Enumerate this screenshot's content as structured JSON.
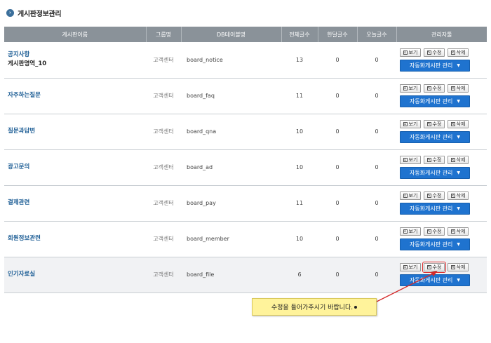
{
  "page": {
    "title": "게시판정보관리",
    "title_icon": "bullet-icon"
  },
  "table": {
    "headers": [
      "게시판이름",
      "그룹명",
      "DB테이블명",
      "전체글수",
      "한달글수",
      "오늘글수",
      "관리자툴"
    ],
    "rows": [
      {
        "name": "공지사항",
        "sub": "게시판명역_10",
        "group": "고객센터",
        "db": "board_notice",
        "total": "13",
        "month": "0",
        "today": "0"
      },
      {
        "name": "자주하는질문",
        "sub": "",
        "group": "고객센터",
        "db": "board_faq",
        "total": "11",
        "month": "0",
        "today": "0"
      },
      {
        "name": "질문과답변",
        "sub": "",
        "group": "고객센터",
        "db": "board_qna",
        "total": "10",
        "month": "0",
        "today": "0"
      },
      {
        "name": "광고문의",
        "sub": "",
        "group": "고객센터",
        "db": "board_ad",
        "total": "10",
        "month": "0",
        "today": "0"
      },
      {
        "name": "결제관련",
        "sub": "",
        "group": "고객센터",
        "db": "board_pay",
        "total": "11",
        "month": "0",
        "today": "0"
      },
      {
        "name": "회원정보관련",
        "sub": "",
        "group": "고객센터",
        "db": "board_member",
        "total": "10",
        "month": "0",
        "today": "0"
      },
      {
        "name": "인기자료실",
        "sub": "",
        "group": "고객센터",
        "db": "board_file",
        "total": "6",
        "month": "0",
        "today": "0"
      }
    ]
  },
  "buttons": {
    "view": "보기",
    "edit": "수정",
    "delete": "삭제",
    "auto_manage": "자동화게시판 관리"
  },
  "callout": {
    "text": "수정을 들어가주시기 바랍니다."
  },
  "colors": {
    "header_bg": "#8a9299",
    "link": "#1f5f96",
    "accent_button": "#1f73cf",
    "callout_bg": "#fff39b",
    "highlight": "#e03030"
  }
}
